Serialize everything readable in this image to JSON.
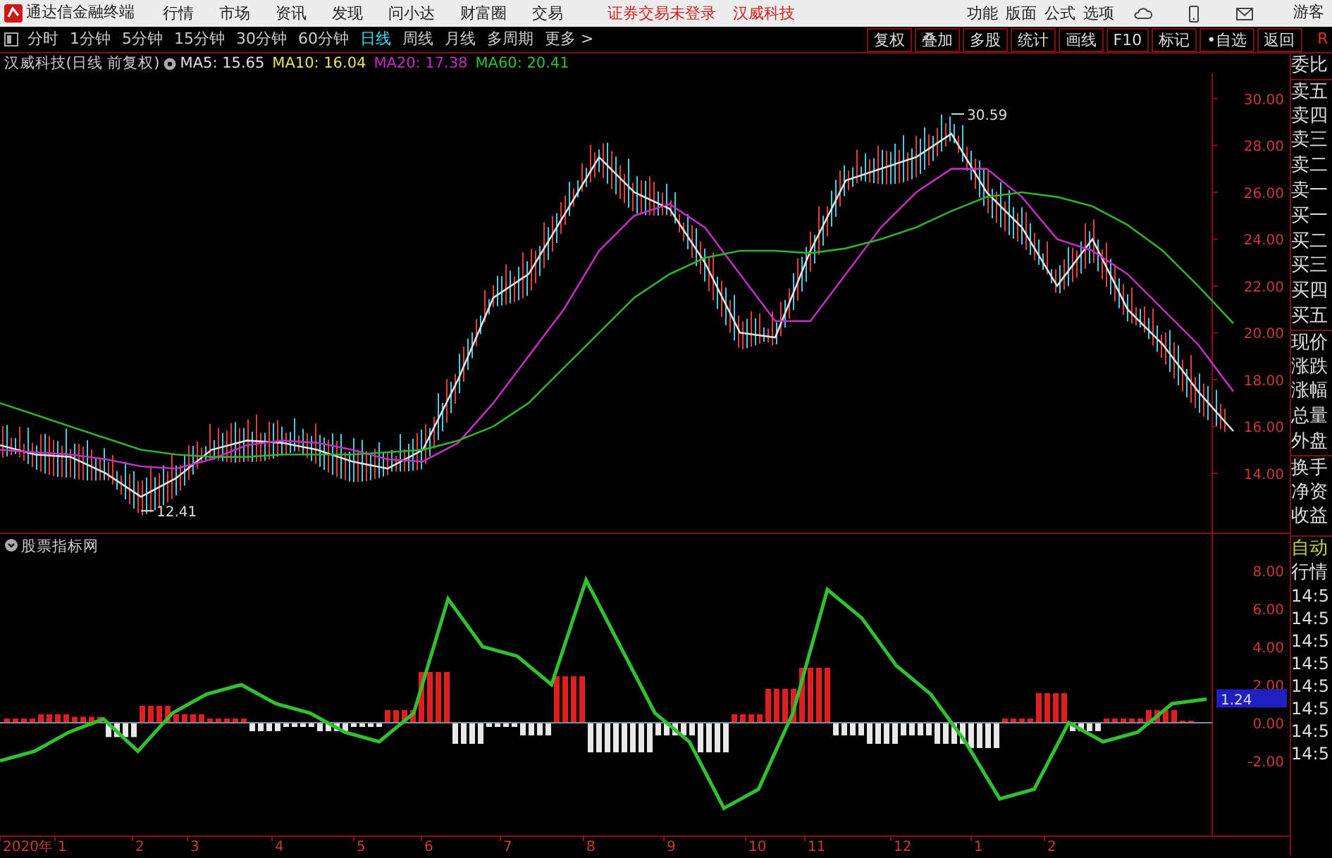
{
  "top_bar": {
    "app_title": "通达信金融终端",
    "menus": [
      "行情",
      "市场",
      "资讯",
      "发现",
      "问小达",
      "财富圈",
      "交易"
    ],
    "notices": [
      "证券交易未登录",
      "汉威科技"
    ],
    "tools": [
      "功能",
      "版面",
      "公式",
      "选项"
    ],
    "user": "游客"
  },
  "toolbar": {
    "periods": [
      {
        "label": "分时",
        "selected": false
      },
      {
        "label": "1分钟",
        "selected": false
      },
      {
        "label": "5分钟",
        "selected": false
      },
      {
        "label": "15分钟",
        "selected": false
      },
      {
        "label": "30分钟",
        "selected": false
      },
      {
        "label": "60分钟",
        "selected": false
      },
      {
        "label": "日线",
        "selected": true
      },
      {
        "label": "周线",
        "selected": false
      },
      {
        "label": "月线",
        "selected": false
      },
      {
        "label": "多周期",
        "selected": false
      },
      {
        "label": "更多 >",
        "selected": false
      }
    ],
    "buttons": [
      "复权",
      "叠加",
      "多股",
      "统计",
      "画线",
      "F10",
      "标记",
      "•自选",
      "返回"
    ],
    "corner": "R"
  },
  "price_chart": {
    "title": "汉威科技(日线 前复权)",
    "ma": [
      {
        "label": "MA5: 15.65",
        "color": "#e0e0e0"
      },
      {
        "label": "MA10: 16.04",
        "color": "#e8e060"
      },
      {
        "label": "MA20: 17.38",
        "color": "#c030c0"
      },
      {
        "label": "MA60: 20.41",
        "color": "#30c030"
      }
    ],
    "chart_data": {
      "type": "line",
      "ylim": [
        11.47,
        31.08
      ],
      "yticks": [
        {
          "value": 30,
          "label": "30.00"
        },
        {
          "value": 28,
          "label": "28.00"
        },
        {
          "value": 26,
          "label": "26.00"
        },
        {
          "value": 24,
          "label": "24.00"
        },
        {
          "value": 22,
          "label": "22.00"
        },
        {
          "value": 20,
          "label": "20.00"
        },
        {
          "value": 18,
          "label": "18.00"
        },
        {
          "value": 16,
          "label": "16.00"
        },
        {
          "value": 14,
          "label": "14.00"
        }
      ],
      "series": [
        {
          "color": "#e0e0e0",
          "values": [
            15.2,
            14.8,
            14.7,
            14.0,
            13.0,
            13.8,
            15.0,
            15.4,
            15.3,
            15.0,
            14.5,
            14.2,
            15.0,
            18.0,
            21.5,
            22.5,
            25.0,
            27.5,
            26.0,
            25.3,
            23.0,
            20.0,
            19.8,
            23.5,
            26.5,
            27.0,
            27.5,
            28.5,
            26.0,
            24.5,
            22.0,
            24.0,
            21.0,
            19.5,
            17.5,
            15.8
          ]
        },
        {
          "color": "#c030c0",
          "values": [
            15.0,
            14.9,
            14.8,
            14.6,
            14.3,
            14.2,
            14.6,
            15.2,
            15.4,
            15.3,
            15.0,
            14.6,
            14.5,
            15.3,
            17.0,
            19.0,
            21.0,
            23.5,
            25.0,
            25.5,
            24.5,
            22.5,
            20.5,
            20.5,
            22.5,
            24.5,
            26.0,
            27.0,
            27.0,
            25.8,
            24.0,
            23.5,
            22.5,
            21.0,
            19.5,
            17.5
          ]
        },
        {
          "color": "#30b030",
          "values": [
            17.0,
            16.5,
            16.0,
            15.5,
            15.0,
            14.8,
            14.7,
            14.7,
            14.8,
            14.8,
            14.8,
            14.9,
            15.0,
            15.4,
            16.0,
            17.0,
            18.5,
            20.0,
            21.5,
            22.5,
            23.2,
            23.5,
            23.5,
            23.4,
            23.6,
            24.0,
            24.5,
            25.2,
            25.8,
            26.0,
            25.8,
            25.4,
            24.6,
            23.5,
            22.0,
            20.4
          ]
        }
      ],
      "annotations": [
        "30.59",
        "12.41"
      ]
    }
  },
  "indicator": {
    "title": "股票指标网",
    "current_value": "1.24",
    "chart_data": {
      "type": "line",
      "ylim": [
        -5.93,
        10
      ],
      "yticks": [
        {
          "value": 8,
          "label": "8.00"
        },
        {
          "value": 6,
          "label": "6.00"
        },
        {
          "value": 4,
          "label": "4.00"
        },
        {
          "value": 2,
          "label": "2.00"
        },
        {
          "value": 0,
          "label": "0.00"
        },
        {
          "value": -2,
          "label": "-2.00"
        }
      ],
      "series": [
        {
          "color": "#30c030",
          "values": [
            -2,
            -1.5,
            -0.5,
            0.2,
            -1.5,
            0.5,
            1.5,
            2.0,
            1.0,
            0.5,
            -0.5,
            -1.0,
            0.5,
            6.5,
            4.0,
            3.5,
            2.0,
            7.5,
            4.0,
            0.5,
            -1.0,
            -4.5,
            -3.5,
            0.5,
            7.0,
            5.5,
            3.0,
            1.5,
            -1.0,
            -4.0,
            -3.5,
            0.0,
            -1.0,
            -0.5,
            1.0,
            1.24
          ]
        }
      ]
    }
  },
  "x_axis_labels": [
    "2020年",
    "1",
    "2",
    "3",
    "4",
    "5",
    "6",
    "7",
    "8",
    "9",
    "10",
    "11",
    "12",
    "1",
    "2"
  ],
  "side_panel": {
    "quote_labels": [
      "委比",
      "卖五",
      "卖四",
      "卖三",
      "卖二",
      "卖一",
      "买一",
      "买二",
      "买三",
      "买四",
      "买五",
      "现价",
      "涨跌",
      "涨幅",
      "总量",
      "外盘",
      "换手",
      "净资",
      "收益"
    ],
    "tabs": [
      {
        "label": "自动",
        "selected": true
      },
      {
        "label": "行情",
        "selected": false
      }
    ],
    "times": [
      "14:5",
      "14:5",
      "14:5",
      "14:5",
      "14:5",
      "14:5",
      "14:5",
      "14:5"
    ]
  }
}
